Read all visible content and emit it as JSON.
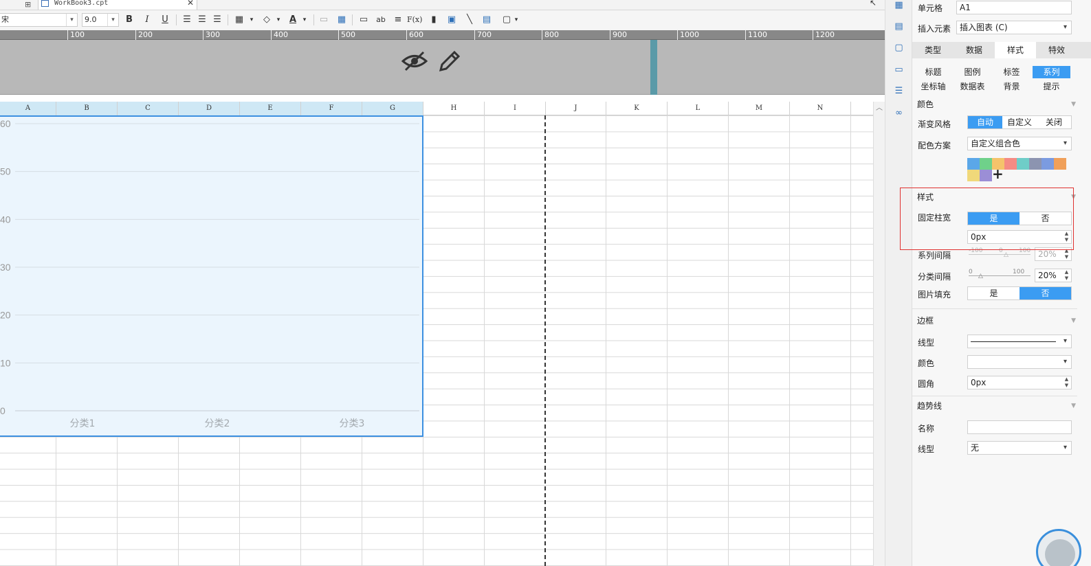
{
  "tab": {
    "file_name": "WorkBook3.cpt"
  },
  "toolbar": {
    "font_name": "宋",
    "font_size": "9.0",
    "bold": "B",
    "italic": "I",
    "underline": "U",
    "text_tool": "ab",
    "formula": "F(x)",
    "text_color_icon": "A"
  },
  "ruler": {
    "marks": [
      "100",
      "200",
      "300",
      "400",
      "500",
      "600",
      "700",
      "800",
      "900",
      "1000",
      "1100",
      "1200"
    ]
  },
  "columns": [
    "A",
    "B",
    "C",
    "D",
    "E",
    "F",
    "G",
    "H",
    "I",
    "J",
    "K",
    "L",
    "M",
    "N"
  ],
  "chart_data": {
    "type": "bar",
    "title": "",
    "categories": [
      "分类1",
      "分类2",
      "分类3"
    ],
    "series": [],
    "y_ticks": [
      "60",
      "50",
      "40",
      "30",
      "20",
      "10",
      "0"
    ],
    "ylim": [
      0,
      60
    ],
    "grid": true,
    "background": "#ebf5fd"
  },
  "panel": {
    "cell_label": "单元格",
    "cell_value": "A1",
    "insert_label": "插入元素",
    "insert_value": "插入图表 (C)",
    "tabs": [
      "类型",
      "数据",
      "样式",
      "特效"
    ],
    "active_tab": "样式",
    "subtabs_row1": [
      "标题",
      "图例",
      "标签",
      "系列"
    ],
    "subtabs_row2": [
      "坐标轴",
      "数据表",
      "背景",
      "提示"
    ],
    "active_subtab": "系列",
    "color_section": "颜色",
    "gradient_label": "渐变风格",
    "gradient_options": [
      "自动",
      "自定义",
      "关闭"
    ],
    "scheme_label": "配色方案",
    "scheme_value": "自定义组合色",
    "palette": [
      "#5ba7e8",
      "#6fd18a",
      "#f5c36b",
      "#f58b84",
      "#6fcdc8",
      "#8c94b0",
      "#7b9be0",
      "#f0a05a",
      "#f0d87a",
      "#9b8ed6"
    ],
    "add_color": "+",
    "style_section": "样式",
    "fixed_width_label": "固定柱宽",
    "yes": "是",
    "no": "否",
    "fixed_width_value": "0px",
    "series_gap_label": "系列间隔",
    "series_gap_ticks": [
      "-100",
      "0",
      "100"
    ],
    "series_gap_value": "20%",
    "category_gap_label": "分类间隔",
    "category_gap_ticks": [
      "0",
      "100"
    ],
    "category_gap_value": "20%",
    "image_fill_label": "图片填充",
    "border_section": "边框",
    "line_type_label": "线型",
    "color_label": "颜色",
    "radius_label": "圆角",
    "radius_value": "0px",
    "trend_section": "趋势线",
    "name_label": "名称",
    "name_value": "",
    "trend_line_label": "线型",
    "trend_line_value": "无"
  }
}
